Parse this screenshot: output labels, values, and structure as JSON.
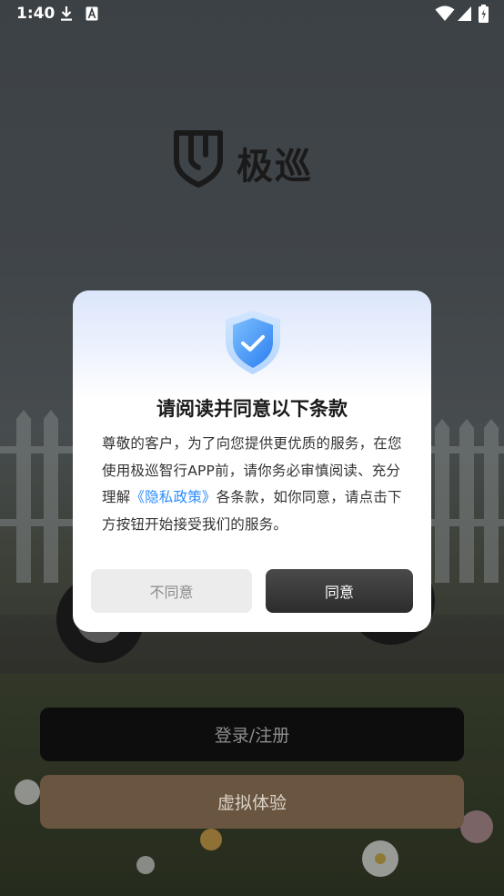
{
  "status_bar": {
    "time": "1:40",
    "icons": [
      "download-icon",
      "a-icon",
      "wifi-icon",
      "signal-icon",
      "battery-icon"
    ]
  },
  "logo": {
    "icon": "shield-logo-icon",
    "text": "极巡"
  },
  "dialog": {
    "icon": "shield-check-icon",
    "title": "请阅读并同意以下条款",
    "body_part1": "尊敬的客户，为了向您提供更优质的服务，在您使用极巡智行APP前，请你务必审慎阅读、充分理解",
    "policy_link": "《隐私政策》",
    "body_part2": "各条款，如你同意，请点击下方按钮开始接受我们的服务。",
    "disagree_label": "不同意",
    "agree_label": "同意"
  },
  "buttons": {
    "login_label": "登录/注册",
    "demo_label": "虚拟体验"
  },
  "colors": {
    "link": "#2b8cff",
    "agree_bg": "#333333",
    "disagree_bg": "#ececec",
    "login_bg": "#0d0d0d",
    "demo_bg": "#6a5640"
  }
}
